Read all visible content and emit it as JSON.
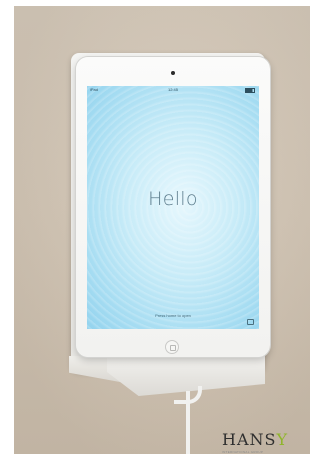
{
  "screen": {
    "status_carrier": "iPad",
    "status_time": "12:45",
    "greeting": "Hello",
    "slide_hint": "Press home to open"
  },
  "watermark": {
    "brand_main": "HANS",
    "brand_accent": "Y",
    "tagline": "INTERNATIONAL GROUP"
  },
  "colors": {
    "wall": "#d4c7b6",
    "screen_center": "#e6f7fd",
    "screen_edge": "#93d3ee",
    "device_body": "#f7f7f5",
    "brand_accent": "#8fb52a"
  }
}
